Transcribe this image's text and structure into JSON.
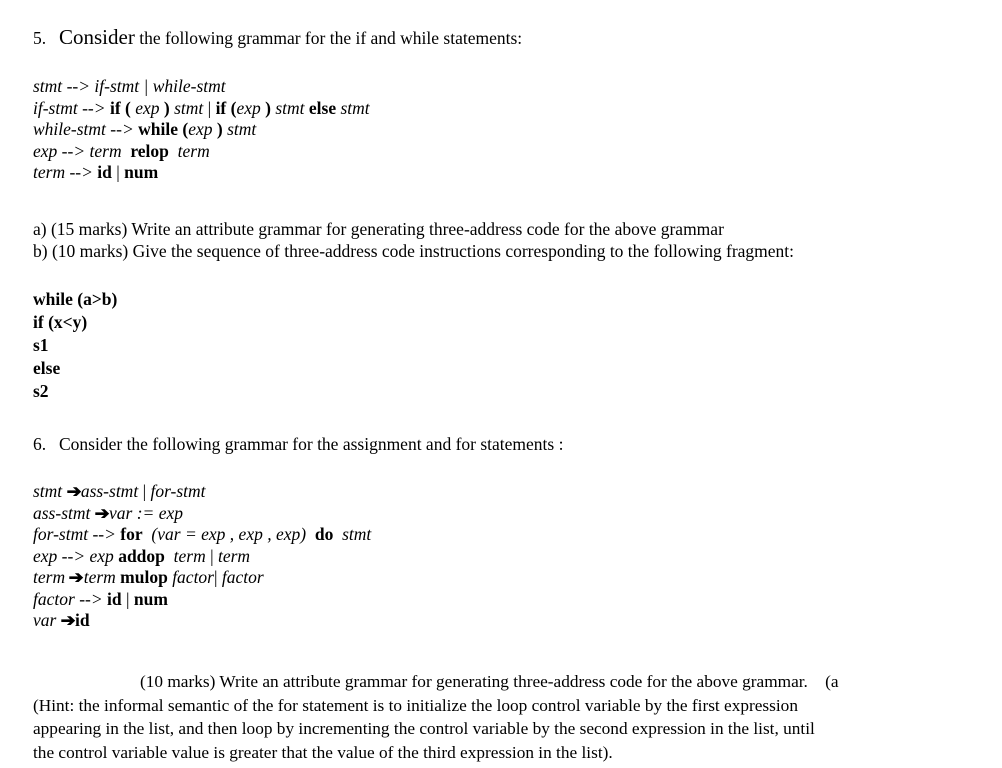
{
  "document": {
    "background_color": "#ffffff",
    "text_color": "#000000"
  },
  "question5": {
    "number": "5.",
    "heading_emph": "Consider",
    "heading_rest": " the following grammar for the if and while statements:",
    "grammar": {
      "line1": {
        "lhs": "stmt",
        "arrow": " --> ",
        "rhs_a": "if-stmt",
        "bar": " | ",
        "rhs_b": "while-stmt"
      },
      "line2": {
        "lhs": "if-stmt",
        "arrow": " --> ",
        "kw1": "if (",
        "exp1": "exp",
        "close1": ")",
        "stmt1": "stmt",
        "bar": "|",
        "kw2": "if",
        "open2": "(",
        "exp2": "exp",
        "close2": ")",
        "stmt2": "stmt",
        "kw3": "else",
        "stmt3": "stmt"
      },
      "line3": {
        "lhs": "while-stmt",
        "arrow": " --> ",
        "kw": "while",
        "open": "(",
        "exp": "exp",
        "close": ")",
        "stmt": "stmt"
      },
      "line4": {
        "lhs": "exp",
        "arrow": " --> ",
        "term1": "term",
        "op": "relop",
        "term2": "term"
      },
      "line5": {
        "lhs": "term",
        "arrow": " --> ",
        "id": "id",
        "bar": "|",
        "num": "num"
      }
    },
    "part_a": "a) (15 marks) Write an attribute grammar for generating three-address code for the above grammar",
    "part_b": "b) (10 marks) Give the sequence of three-address code instructions corresponding to the following fragment:",
    "code_fragment": [
      "while (a>b)",
      "if (x<y)",
      "s1",
      "else",
      "s2"
    ]
  },
  "question6": {
    "number": "6.",
    "heading": "Consider the following grammar for the assignment and for statements :",
    "grammar": {
      "line1": {
        "lhs": "stmt",
        "arrow": "➔",
        "rhs_a": "ass-stmt",
        "bar": "|",
        "rhs_b": "for-stmt"
      },
      "line2": {
        "lhs": "ass-stmt",
        "arrow": "➔",
        "var": "var",
        "assign": ":=",
        "exp": "exp"
      },
      "line3": {
        "lhs": "for-stmt",
        "arrow": " --> ",
        "kw_for": "for",
        "open": "(",
        "var": "var",
        "eq": "=",
        "exp1": "exp",
        "comma1": ",",
        "exp2": "exp",
        "comma2": ",",
        "exp3": "exp",
        "close": ")",
        "kw_do": "do",
        "stmt": "stmt"
      },
      "line4": {
        "lhs": "exp",
        "arrow": " --> ",
        "exp": "exp",
        "op": "addop",
        "term1": "term",
        "bar": "|",
        "term2": "term"
      },
      "line5": {
        "lhs": "term",
        "arrow": "➔",
        "term1": "term",
        "op": "mulop",
        "factor1": "factor",
        "bar": "|",
        "factor2": "factor"
      },
      "line6": {
        "lhs": "factor",
        "arrow": " --> ",
        "id": "id",
        "bar": "|",
        "num": "num"
      },
      "line7": {
        "lhs": "var",
        "arrow": "➔",
        "id": "id"
      }
    },
    "final_paragraph": {
      "line1": "(10 marks) Write an attribute grammar for generating three-address code for the above grammar.",
      "line1_tail": "(a",
      "line2": "(Hint: the informal semantic of the for statement is to initialize the loop control variable by the first expression",
      "line3": "appearing in the list, and then loop by incrementing the control variable by the second expression in the list, until",
      "line4": "the control variable value is greater that the value of the third expression in the list)."
    }
  }
}
